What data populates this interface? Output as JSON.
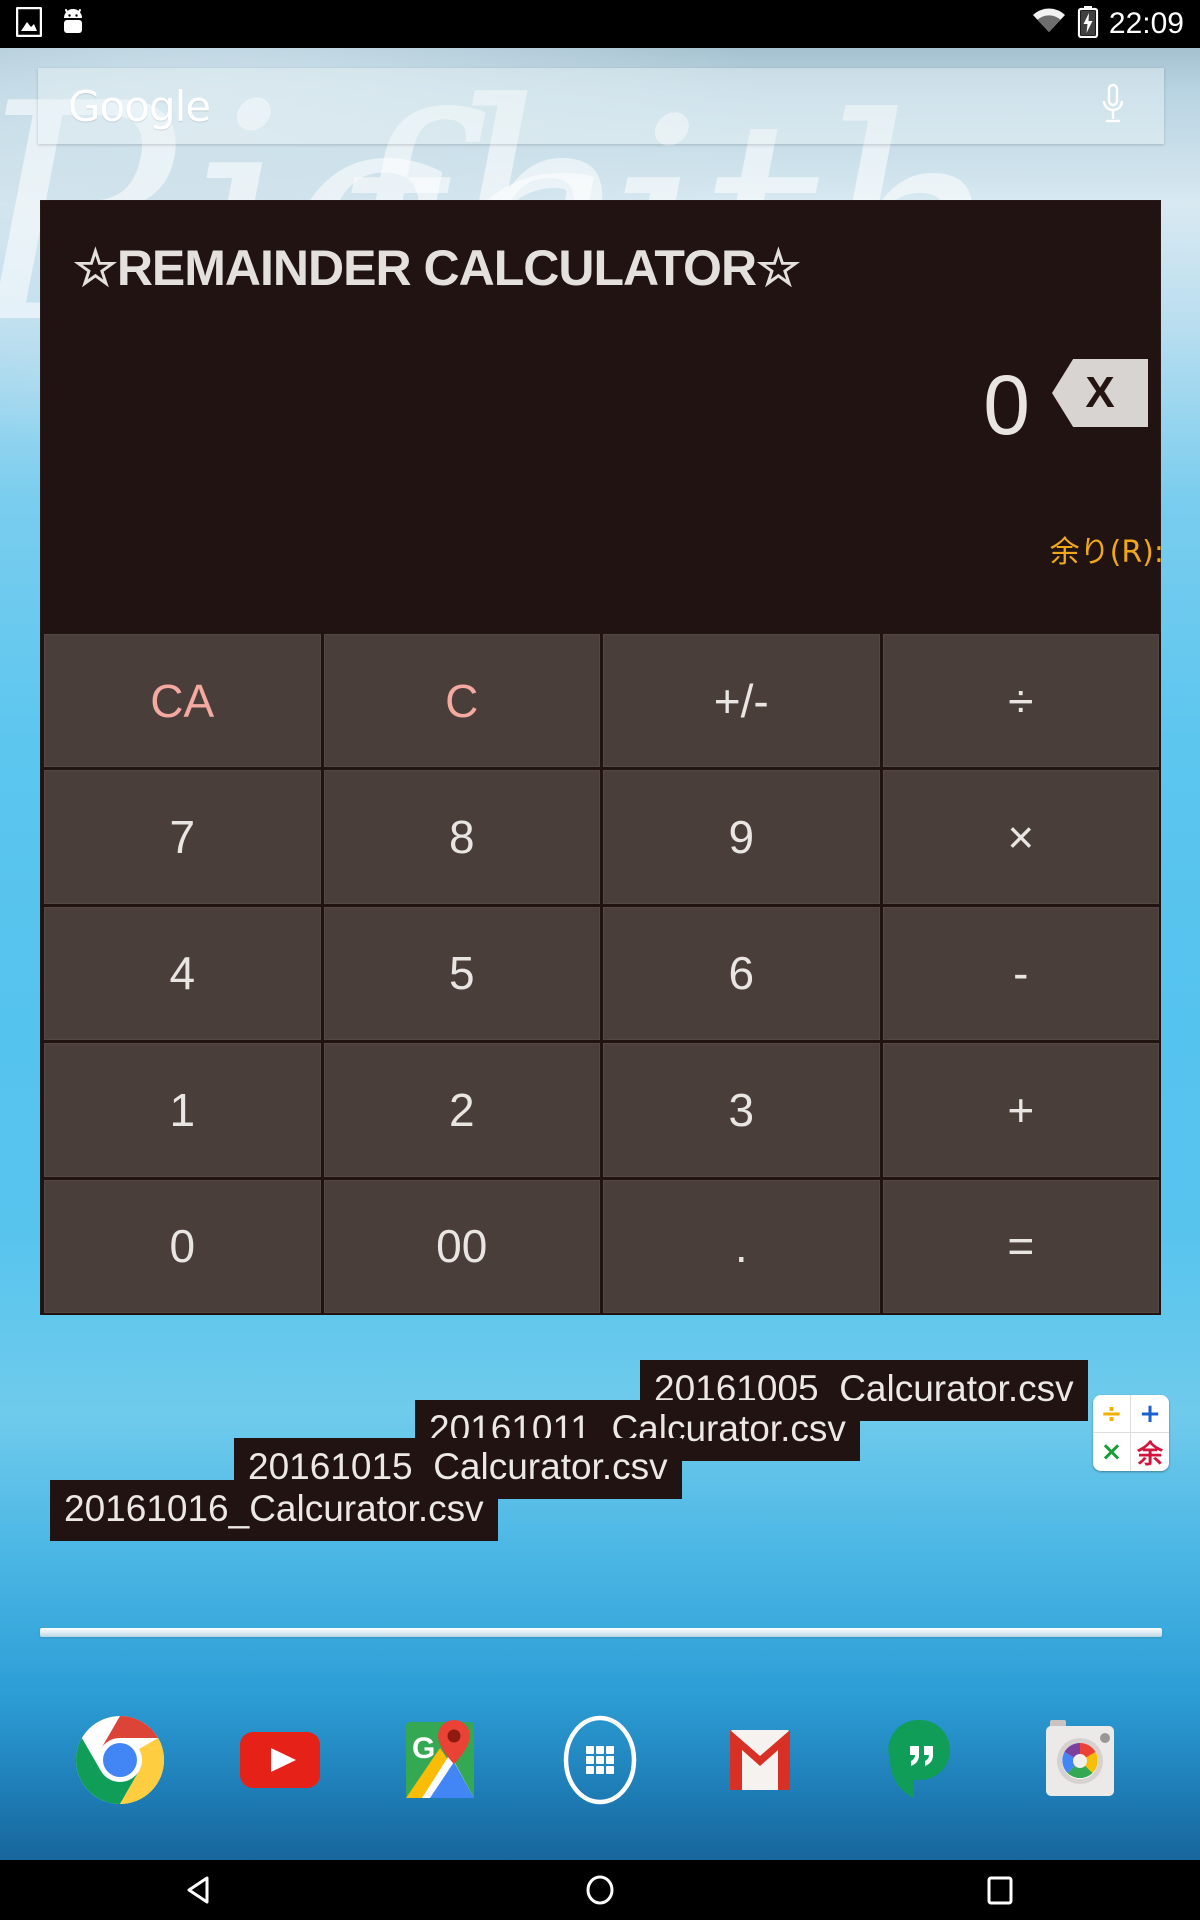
{
  "status_bar": {
    "icons": [
      "image-icon",
      "android-icon"
    ],
    "wifi_icon": "wifi-icon",
    "battery_icon": "battery-charging-icon",
    "clock": "22:09"
  },
  "search_bar": {
    "logo_text": "Google",
    "mic_icon": "microphone-icon",
    "placeholder": ""
  },
  "calculator": {
    "title": "☆REMAINDER CALCULATOR☆",
    "display_value": "0",
    "backspace_label": "X",
    "remainder_label": "余り(R):",
    "accent_color": "#f4a9a1",
    "remainder_color": "#f0a818",
    "key_color": "#4a3e3b",
    "panel_color": "#201311",
    "keys": [
      {
        "label": "CA",
        "name": "clear-all-key",
        "style": "accent"
      },
      {
        "label": "C",
        "name": "clear-key",
        "style": "accent"
      },
      {
        "label": "+/-",
        "name": "sign-key",
        "style": "normal"
      },
      {
        "label": "÷",
        "name": "divide-key",
        "style": "op"
      },
      {
        "label": "7",
        "name": "digit-7-key",
        "style": "normal"
      },
      {
        "label": "8",
        "name": "digit-8-key",
        "style": "normal"
      },
      {
        "label": "9",
        "name": "digit-9-key",
        "style": "normal"
      },
      {
        "label": "×",
        "name": "multiply-key",
        "style": "op"
      },
      {
        "label": "4",
        "name": "digit-4-key",
        "style": "normal"
      },
      {
        "label": "5",
        "name": "digit-5-key",
        "style": "normal"
      },
      {
        "label": "6",
        "name": "digit-6-key",
        "style": "normal"
      },
      {
        "label": "-",
        "name": "minus-key",
        "style": "op"
      },
      {
        "label": "1",
        "name": "digit-1-key",
        "style": "normal"
      },
      {
        "label": "2",
        "name": "digit-2-key",
        "style": "normal"
      },
      {
        "label": "3",
        "name": "digit-3-key",
        "style": "normal"
      },
      {
        "label": "+",
        "name": "plus-key",
        "style": "op"
      },
      {
        "label": "0",
        "name": "digit-0-key",
        "style": "normal"
      },
      {
        "label": "00",
        "name": "digit-00-key",
        "style": "normal"
      },
      {
        "label": ".",
        "name": "decimal-key",
        "style": "normal"
      },
      {
        "label": "=",
        "name": "equals-key",
        "style": "op"
      }
    ]
  },
  "toasts": [
    {
      "text": "20161016_Calcurator.csv"
    },
    {
      "text": "20161015_Calcurator.csv"
    },
    {
      "text": "20161011_Calcurator.csv"
    },
    {
      "text": "20161005_Calcurator.csv"
    }
  ],
  "app_icon": {
    "quadrants": [
      {
        "glyph": "÷",
        "name": "divide-quadrant",
        "color": "#f0b000"
      },
      {
        "glyph": "+",
        "name": "plus-quadrant",
        "color": "#1a62d0"
      },
      {
        "glyph": "×",
        "name": "multiply-quadrant",
        "color": "#1a9d3a"
      },
      {
        "glyph": "余",
        "name": "remainder-quadrant",
        "color": "#d4143c"
      }
    ]
  },
  "dock": {
    "items": [
      {
        "name": "dock-chrome",
        "label": "Chrome"
      },
      {
        "name": "dock-youtube",
        "label": "YouTube"
      },
      {
        "name": "dock-maps",
        "label": "Maps"
      },
      {
        "name": "dock-app-drawer",
        "label": "Apps"
      },
      {
        "name": "dock-gmail",
        "label": "Gmail"
      },
      {
        "name": "dock-hangouts",
        "label": "Hangouts"
      },
      {
        "name": "dock-camera",
        "label": "Camera"
      }
    ]
  },
  "nav_bar": {
    "back": "back-icon",
    "home": "home-icon",
    "recents": "recents-icon"
  },
  "wallpaper": {
    "script_line_1": "Rich",
    "script_line_2": "faith"
  }
}
